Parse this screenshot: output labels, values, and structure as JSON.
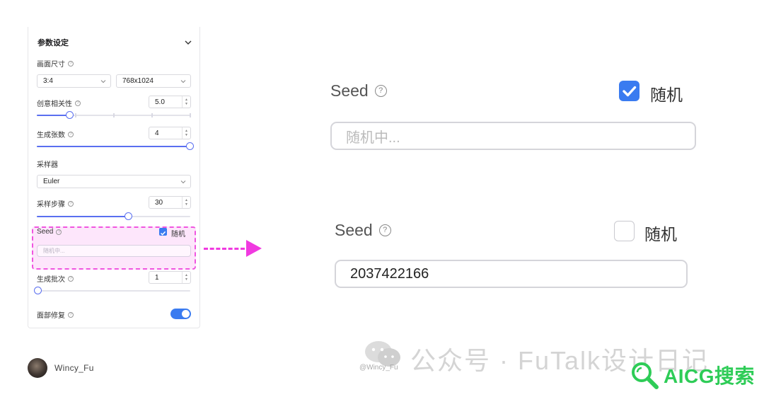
{
  "panel": {
    "title": "参数设定",
    "canvas_size": {
      "label": "画面尺寸",
      "ratio": "3:4",
      "resolution": "768x1024"
    },
    "creativity": {
      "label": "创意相关性",
      "value": "5.0",
      "slider_fraction": 0.21
    },
    "count": {
      "label": "生成张数",
      "value": "4",
      "slider_fraction": 1.0
    },
    "sampler": {
      "label": "采样器",
      "value": "Euler"
    },
    "steps": {
      "label": "采样步骤",
      "value": "30",
      "slider_fraction": 0.59
    },
    "seed": {
      "label": "Seed",
      "random_label": "随机",
      "random_checked": true,
      "placeholder": "随机中..."
    },
    "batch": {
      "label": "生成批次",
      "value": "1",
      "slider_fraction": 0.0
    },
    "face_fix": {
      "label": "面部修复",
      "enabled": true
    }
  },
  "zoom_checked": {
    "seed_label": "Seed",
    "random_label": "随机",
    "checked": true,
    "input_placeholder": "随机中..."
  },
  "zoom_unchecked": {
    "seed_label": "Seed",
    "random_label": "随机",
    "checked": false,
    "input_value": "2037422166"
  },
  "footer": {
    "author": "Wincy_Fu",
    "small_watermark": "@Wincy_Fu",
    "big_watermark": "公众号 · FuTalk设计日记",
    "aicg_text": "AICG搜索"
  },
  "colors": {
    "accent": "#3a7bf0",
    "slider": "#5a6ff0",
    "highlight": "#f055e0",
    "aicg": "#2ecc57"
  },
  "icons": [
    "chevron-down-icon",
    "help-icon",
    "check-icon",
    "wechat-icon",
    "search-icon"
  ]
}
